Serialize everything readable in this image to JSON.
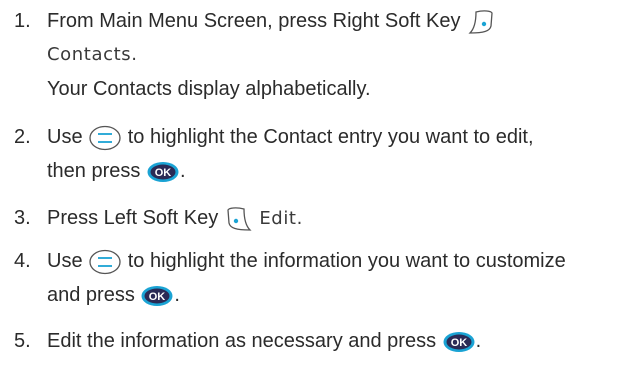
{
  "steps": [
    {
      "number": "1.",
      "text_a": "From Main Menu Screen, press Right Soft Key",
      "icon": "right-soft-key-icon",
      "screen_text": "Contacts.",
      "text_b": "Your Contacts display alphabetically."
    },
    {
      "number": "2.",
      "text_a": "Use",
      "icon": "navigation-key-icon",
      "text_a2": "to highlight the Contact entry you want to edit,",
      "text_b": "then press",
      "icon2": "ok-key-icon",
      "text_b2": "."
    },
    {
      "number": "3.",
      "text_a": "Press Left Soft Key",
      "icon": "left-soft-key-icon",
      "screen_text": "Edit."
    },
    {
      "number": "4.",
      "text_a": "Use",
      "icon": "navigation-key-icon",
      "text_a2": "to highlight the information you want to customize",
      "text_b": "and press",
      "icon2": "ok-key-icon",
      "text_b2": "."
    },
    {
      "number": "5.",
      "text_a": "Edit the information as necessary and press",
      "icon": "ok-key-icon",
      "text_a2": "."
    }
  ],
  "ok_key_label": "OK",
  "colors": {
    "text": "#2b2b2b",
    "key_blue": "#1aa3d4",
    "ok_dark": "#2a2a55"
  }
}
